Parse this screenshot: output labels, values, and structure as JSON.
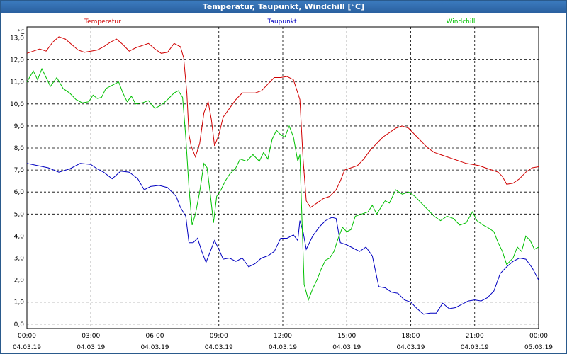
{
  "window": {
    "title": "Temperatur, Taupunkt, Windchill [°C]"
  },
  "chart_data": {
    "type": "line",
    "title": "Temperatur, Taupunkt, Windchill [°C]",
    "ylabel": "°C",
    "ylim": [
      -0.2,
      13.5
    ],
    "y_ticks": [
      "0,0",
      "1,0",
      "2,0",
      "3,0",
      "4,0",
      "5,0",
      "6,0",
      "7,0",
      "8,0",
      "9,0",
      "10,0",
      "11,0",
      "12,0",
      "13,0"
    ],
    "x_ticks": [
      {
        "time": "00:00",
        "date": "04.03.19",
        "h": 0
      },
      {
        "time": "03:00",
        "date": "04.03.19",
        "h": 3
      },
      {
        "time": "06:00",
        "date": "04.03.19",
        "h": 6
      },
      {
        "time": "09:00",
        "date": "04.03.19",
        "h": 9
      },
      {
        "time": "12:00",
        "date": "04.03.19",
        "h": 12
      },
      {
        "time": "15:00",
        "date": "04.03.19",
        "h": 15
      },
      {
        "time": "18:00",
        "date": "04.03.19",
        "h": 18
      },
      {
        "time": "21:00",
        "date": "04.03.19",
        "h": 21
      },
      {
        "time": "00:00",
        "date": "05.03.19",
        "h": 24
      }
    ],
    "grid": true,
    "legend_position": "top",
    "series": [
      {
        "name": "Temperatur",
        "color": "#d00000",
        "points": [
          [
            0,
            12.3
          ],
          [
            0.3,
            12.4
          ],
          [
            0.6,
            12.5
          ],
          [
            0.9,
            12.4
          ],
          [
            1.2,
            12.8
          ],
          [
            1.5,
            13.05
          ],
          [
            1.8,
            12.95
          ],
          [
            2.1,
            12.7
          ],
          [
            2.4,
            12.45
          ],
          [
            2.7,
            12.35
          ],
          [
            3.0,
            12.4
          ],
          [
            3.3,
            12.45
          ],
          [
            3.6,
            12.6
          ],
          [
            3.9,
            12.8
          ],
          [
            4.2,
            12.95
          ],
          [
            4.5,
            12.7
          ],
          [
            4.8,
            12.4
          ],
          [
            5.1,
            12.55
          ],
          [
            5.4,
            12.65
          ],
          [
            5.7,
            12.75
          ],
          [
            6.0,
            12.5
          ],
          [
            6.3,
            12.3
          ],
          [
            6.6,
            12.35
          ],
          [
            6.9,
            12.75
          ],
          [
            7.2,
            12.6
          ],
          [
            7.35,
            12.1
          ],
          [
            7.5,
            10.5
          ],
          [
            7.6,
            8.6
          ],
          [
            7.7,
            8.1
          ],
          [
            7.9,
            7.6
          ],
          [
            8.1,
            8.2
          ],
          [
            8.3,
            9.6
          ],
          [
            8.5,
            10.1
          ],
          [
            8.65,
            9.3
          ],
          [
            8.8,
            8.1
          ],
          [
            9.0,
            8.6
          ],
          [
            9.2,
            9.4
          ],
          [
            9.5,
            9.8
          ],
          [
            9.8,
            10.2
          ],
          [
            10.1,
            10.5
          ],
          [
            10.4,
            10.5
          ],
          [
            10.7,
            10.5
          ],
          [
            11.0,
            10.6
          ],
          [
            11.3,
            10.9
          ],
          [
            11.6,
            11.2
          ],
          [
            11.9,
            11.2
          ],
          [
            12.2,
            11.25
          ],
          [
            12.5,
            11.1
          ],
          [
            12.7,
            10.5
          ],
          [
            12.8,
            10.2
          ],
          [
            12.95,
            7.5
          ],
          [
            13.1,
            5.6
          ],
          [
            13.3,
            5.3
          ],
          [
            13.6,
            5.5
          ],
          [
            13.9,
            5.7
          ],
          [
            14.2,
            5.8
          ],
          [
            14.5,
            6.1
          ],
          [
            14.7,
            6.5
          ],
          [
            14.9,
            7.0
          ],
          [
            15.2,
            7.1
          ],
          [
            15.5,
            7.2
          ],
          [
            15.8,
            7.5
          ],
          [
            16.1,
            7.9
          ],
          [
            16.4,
            8.2
          ],
          [
            16.7,
            8.5
          ],
          [
            17.0,
            8.7
          ],
          [
            17.3,
            8.9
          ],
          [
            17.6,
            9.0
          ],
          [
            17.9,
            8.9
          ],
          [
            18.2,
            8.6
          ],
          [
            18.5,
            8.3
          ],
          [
            18.8,
            8.0
          ],
          [
            19.1,
            7.8
          ],
          [
            19.4,
            7.7
          ],
          [
            19.7,
            7.6
          ],
          [
            20.0,
            7.5
          ],
          [
            20.3,
            7.4
          ],
          [
            20.6,
            7.3
          ],
          [
            20.9,
            7.25
          ],
          [
            21.2,
            7.2
          ],
          [
            21.5,
            7.1
          ],
          [
            21.8,
            7.0
          ],
          [
            22.1,
            6.9
          ],
          [
            22.3,
            6.7
          ],
          [
            22.5,
            6.35
          ],
          [
            22.8,
            6.4
          ],
          [
            23.1,
            6.6
          ],
          [
            23.4,
            6.9
          ],
          [
            23.7,
            7.1
          ],
          [
            24.0,
            7.15
          ]
        ]
      },
      {
        "name": "Taupunkt",
        "color": "#0000c0",
        "points": [
          [
            0,
            7.3
          ],
          [
            0.5,
            7.2
          ],
          [
            1.0,
            7.1
          ],
          [
            1.5,
            6.9
          ],
          [
            2.0,
            7.05
          ],
          [
            2.5,
            7.3
          ],
          [
            3.0,
            7.25
          ],
          [
            3.3,
            7.05
          ],
          [
            3.6,
            6.9
          ],
          [
            4.0,
            6.6
          ],
          [
            4.4,
            6.95
          ],
          [
            4.8,
            6.9
          ],
          [
            5.2,
            6.6
          ],
          [
            5.5,
            6.1
          ],
          [
            5.8,
            6.25
          ],
          [
            6.2,
            6.3
          ],
          [
            6.6,
            6.2
          ],
          [
            7.0,
            5.8
          ],
          [
            7.2,
            5.3
          ],
          [
            7.45,
            4.9
          ],
          [
            7.6,
            3.7
          ],
          [
            7.8,
            3.7
          ],
          [
            8.0,
            3.9
          ],
          [
            8.2,
            3.3
          ],
          [
            8.4,
            2.8
          ],
          [
            8.6,
            3.3
          ],
          [
            8.8,
            3.8
          ],
          [
            9.0,
            3.4
          ],
          [
            9.2,
            2.95
          ],
          [
            9.5,
            3.0
          ],
          [
            9.8,
            2.85
          ],
          [
            10.1,
            3.0
          ],
          [
            10.4,
            2.6
          ],
          [
            10.7,
            2.75
          ],
          [
            11.0,
            3.0
          ],
          [
            11.3,
            3.1
          ],
          [
            11.6,
            3.3
          ],
          [
            11.9,
            3.9
          ],
          [
            12.2,
            3.9
          ],
          [
            12.5,
            4.05
          ],
          [
            12.7,
            3.8
          ],
          [
            12.8,
            4.7
          ],
          [
            12.95,
            4.2
          ],
          [
            13.1,
            3.4
          ],
          [
            13.4,
            4.0
          ],
          [
            13.7,
            4.4
          ],
          [
            14.0,
            4.7
          ],
          [
            14.3,
            4.85
          ],
          [
            14.5,
            4.8
          ],
          [
            14.7,
            3.7
          ],
          [
            15.0,
            3.6
          ],
          [
            15.3,
            3.45
          ],
          [
            15.6,
            3.3
          ],
          [
            15.9,
            3.5
          ],
          [
            16.2,
            3.1
          ],
          [
            16.5,
            1.7
          ],
          [
            16.8,
            1.65
          ],
          [
            17.1,
            1.45
          ],
          [
            17.4,
            1.4
          ],
          [
            17.7,
            1.1
          ],
          [
            18.0,
            1.0
          ],
          [
            18.3,
            0.7
          ],
          [
            18.6,
            0.45
          ],
          [
            18.9,
            0.5
          ],
          [
            19.2,
            0.5
          ],
          [
            19.5,
            0.95
          ],
          [
            19.8,
            0.7
          ],
          [
            20.1,
            0.75
          ],
          [
            20.4,
            0.9
          ],
          [
            20.7,
            1.05
          ],
          [
            21.0,
            1.1
          ],
          [
            21.3,
            1.05
          ],
          [
            21.6,
            1.2
          ],
          [
            21.9,
            1.5
          ],
          [
            22.2,
            2.3
          ],
          [
            22.5,
            2.6
          ],
          [
            22.8,
            2.85
          ],
          [
            23.1,
            3.0
          ],
          [
            23.4,
            2.95
          ],
          [
            23.7,
            2.55
          ],
          [
            24.0,
            2.0
          ]
        ]
      },
      {
        "name": "Windchill",
        "color": "#00c000",
        "points": [
          [
            0,
            11.0
          ],
          [
            0.3,
            11.5
          ],
          [
            0.5,
            11.1
          ],
          [
            0.7,
            11.6
          ],
          [
            0.9,
            11.2
          ],
          [
            1.1,
            10.8
          ],
          [
            1.4,
            11.2
          ],
          [
            1.7,
            10.7
          ],
          [
            2.0,
            10.5
          ],
          [
            2.3,
            10.2
          ],
          [
            2.6,
            10.05
          ],
          [
            2.9,
            10.1
          ],
          [
            3.1,
            10.4
          ],
          [
            3.3,
            10.25
          ],
          [
            3.5,
            10.3
          ],
          [
            3.7,
            10.7
          ],
          [
            4.0,
            10.85
          ],
          [
            4.3,
            11.0
          ],
          [
            4.5,
            10.5
          ],
          [
            4.7,
            10.1
          ],
          [
            4.9,
            10.35
          ],
          [
            5.1,
            10.0
          ],
          [
            5.4,
            10.05
          ],
          [
            5.7,
            10.15
          ],
          [
            6.0,
            9.8
          ],
          [
            6.3,
            9.95
          ],
          [
            6.6,
            10.2
          ],
          [
            6.9,
            10.5
          ],
          [
            7.1,
            10.6
          ],
          [
            7.3,
            10.3
          ],
          [
            7.45,
            8.5
          ],
          [
            7.6,
            6.2
          ],
          [
            7.75,
            4.5
          ],
          [
            7.9,
            5.0
          ],
          [
            8.1,
            6.0
          ],
          [
            8.3,
            7.3
          ],
          [
            8.45,
            7.1
          ],
          [
            8.6,
            5.9
          ],
          [
            8.75,
            4.6
          ],
          [
            8.9,
            5.8
          ],
          [
            9.1,
            6.1
          ],
          [
            9.3,
            6.5
          ],
          [
            9.5,
            6.8
          ],
          [
            9.8,
            7.1
          ],
          [
            10.0,
            7.5
          ],
          [
            10.3,
            7.4
          ],
          [
            10.6,
            7.7
          ],
          [
            10.9,
            7.4
          ],
          [
            11.1,
            7.8
          ],
          [
            11.3,
            7.5
          ],
          [
            11.5,
            8.4
          ],
          [
            11.7,
            8.8
          ],
          [
            11.9,
            8.6
          ],
          [
            12.1,
            8.5
          ],
          [
            12.3,
            9.0
          ],
          [
            12.5,
            8.5
          ],
          [
            12.7,
            7.4
          ],
          [
            12.8,
            7.7
          ],
          [
            12.9,
            4.7
          ],
          [
            13.0,
            1.8
          ],
          [
            13.2,
            1.1
          ],
          [
            13.4,
            1.6
          ],
          [
            13.6,
            2.0
          ],
          [
            13.8,
            2.5
          ],
          [
            14.0,
            2.9
          ],
          [
            14.2,
            3.0
          ],
          [
            14.4,
            3.3
          ],
          [
            14.6,
            3.9
          ],
          [
            14.8,
            4.4
          ],
          [
            15.0,
            4.2
          ],
          [
            15.2,
            4.3
          ],
          [
            15.4,
            4.9
          ],
          [
            15.7,
            5.0
          ],
          [
            16.0,
            5.1
          ],
          [
            16.2,
            5.4
          ],
          [
            16.4,
            5.0
          ],
          [
            16.6,
            5.3
          ],
          [
            16.8,
            5.6
          ],
          [
            17.0,
            5.5
          ],
          [
            17.3,
            6.1
          ],
          [
            17.6,
            5.9
          ],
          [
            17.9,
            6.0
          ],
          [
            18.2,
            5.8
          ],
          [
            18.5,
            5.5
          ],
          [
            18.8,
            5.2
          ],
          [
            19.1,
            4.9
          ],
          [
            19.4,
            4.7
          ],
          [
            19.7,
            4.9
          ],
          [
            20.0,
            4.8
          ],
          [
            20.3,
            4.5
          ],
          [
            20.6,
            4.6
          ],
          [
            20.9,
            5.1
          ],
          [
            21.1,
            4.7
          ],
          [
            21.4,
            4.5
          ],
          [
            21.6,
            4.4
          ],
          [
            21.9,
            4.2
          ],
          [
            22.1,
            3.7
          ],
          [
            22.3,
            3.3
          ],
          [
            22.5,
            2.7
          ],
          [
            22.8,
            3.0
          ],
          [
            23.0,
            3.5
          ],
          [
            23.2,
            3.3
          ],
          [
            23.4,
            4.0
          ],
          [
            23.6,
            3.8
          ],
          [
            23.8,
            3.4
          ],
          [
            24.0,
            3.5
          ]
        ]
      }
    ]
  }
}
